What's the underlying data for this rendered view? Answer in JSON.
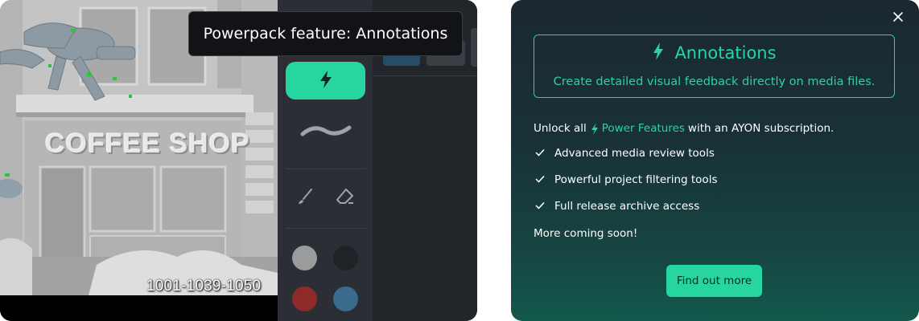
{
  "viewer": {
    "frame_label": "1001-1039-1050",
    "shop_sign": "COFFEE SHOP",
    "tooltip": "Powerpack feature: Annotations",
    "tools": {
      "annotate_icon": "bolt-icon",
      "stroke_icon": "wavy-line-icon",
      "brush_icon": "brush-icon",
      "eraser_icon": "eraser-icon"
    },
    "swatches": [
      {
        "name": "light-gray",
        "color": "#9a9b9d"
      },
      {
        "name": "black",
        "color": "#1f2227"
      },
      {
        "name": "red",
        "color": "#8e2a2a"
      },
      {
        "name": "blue",
        "color": "#3a6a8c"
      }
    ],
    "accent_color": "#27d5a1"
  },
  "modal": {
    "close_icon": "close-icon",
    "feature": {
      "icon": "bolt-icon",
      "title": "Annotations",
      "description": "Create detailed visual feedback directly on media files."
    },
    "unlock": {
      "prefix": "Unlock all",
      "link_text": "Power Features",
      "suffix": "with an AYON subscription."
    },
    "benefits": [
      "Advanced media review tools",
      "Powerful project filtering tools",
      "Full release archive access"
    ],
    "coming_soon": "More coming soon!",
    "cta_label": "Find out more",
    "accent_color": "#27d5a1"
  }
}
